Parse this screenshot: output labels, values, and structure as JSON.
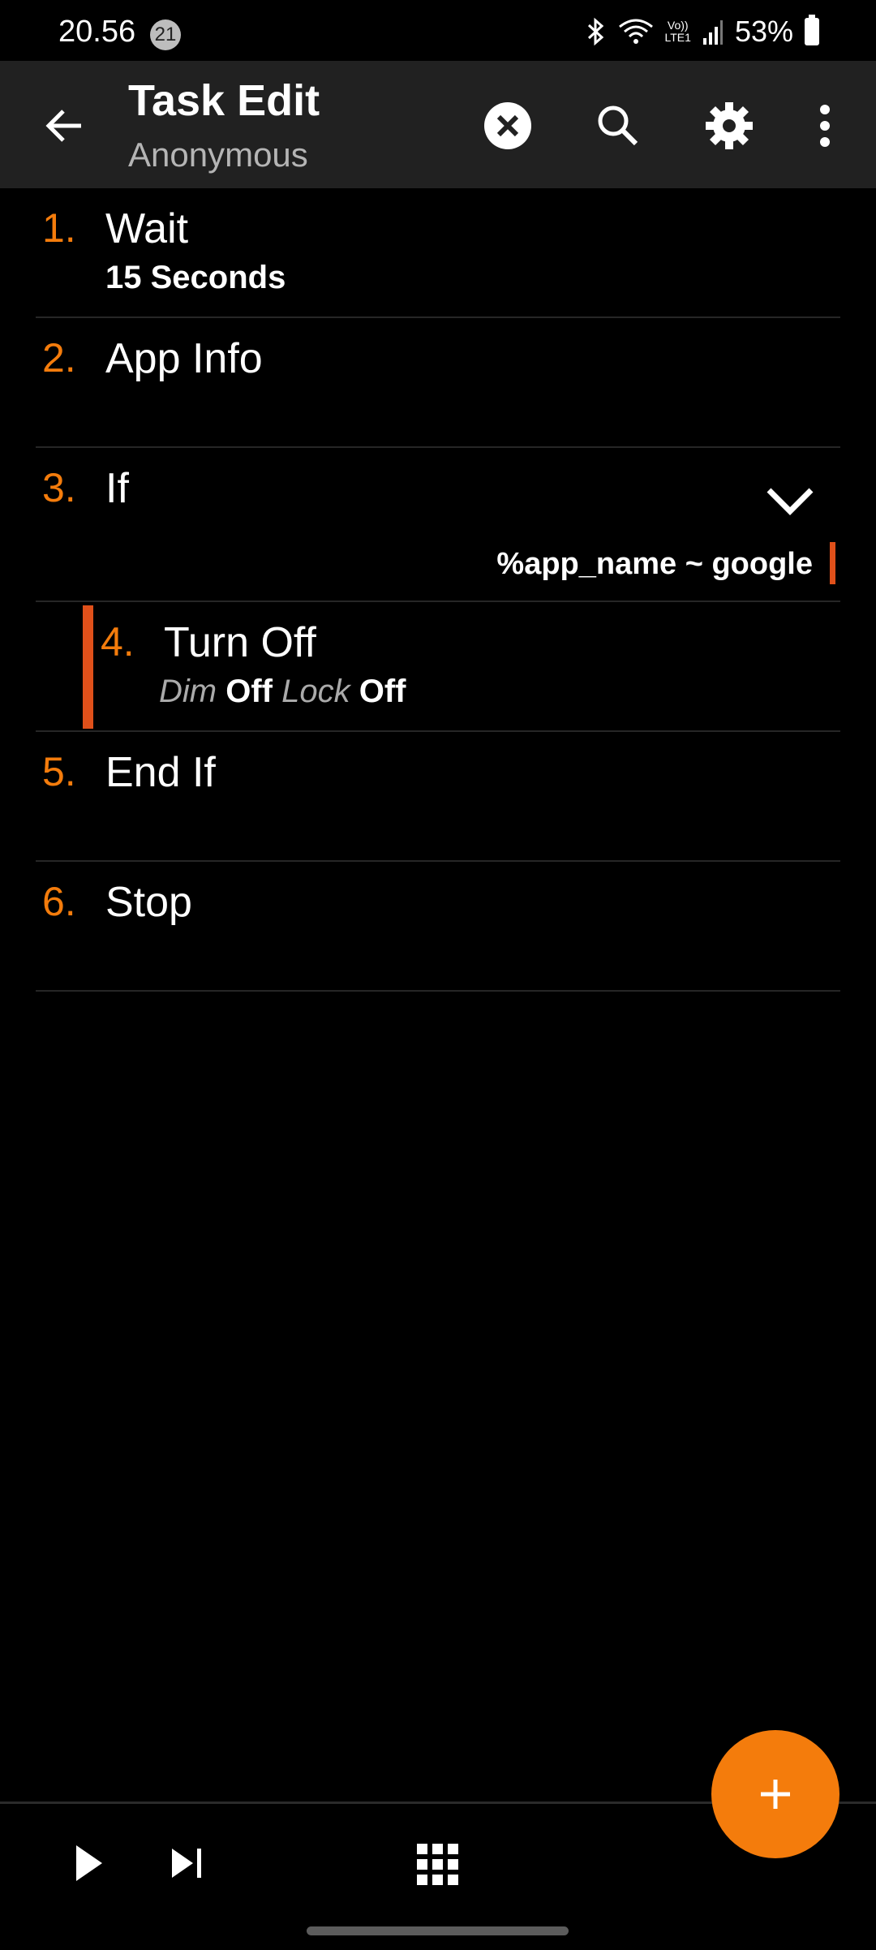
{
  "status_bar": {
    "time": "20.56",
    "notification_count": "21",
    "icons": [
      "bluetooth-icon",
      "wifi-icon",
      "volte-lte-icon",
      "signal-icon"
    ],
    "volte_label": "Vo))",
    "lte_label": "LTE1",
    "battery_percent": "53%"
  },
  "toolbar": {
    "title": "Task Edit",
    "subtitle": "Anonymous",
    "actions": [
      "clear",
      "search",
      "settings",
      "more"
    ]
  },
  "actions": [
    {
      "number": "1.",
      "name": "Wait",
      "detail": "15 Seconds"
    },
    {
      "number": "2.",
      "name": "App Info"
    },
    {
      "number": "3.",
      "name": "If",
      "condition": "%app_name ~ google"
    },
    {
      "number": "4.",
      "name": "Turn Off",
      "params": [
        {
          "key": "Dim",
          "value": "Off"
        },
        {
          "key": "Lock",
          "value": "Off"
        }
      ]
    },
    {
      "number": "5.",
      "name": "End If"
    },
    {
      "number": "6.",
      "name": "Stop"
    }
  ],
  "colors": {
    "accent": "#f47c0c",
    "block_bar": "#e0501a",
    "toolbar_bg": "#212121"
  }
}
